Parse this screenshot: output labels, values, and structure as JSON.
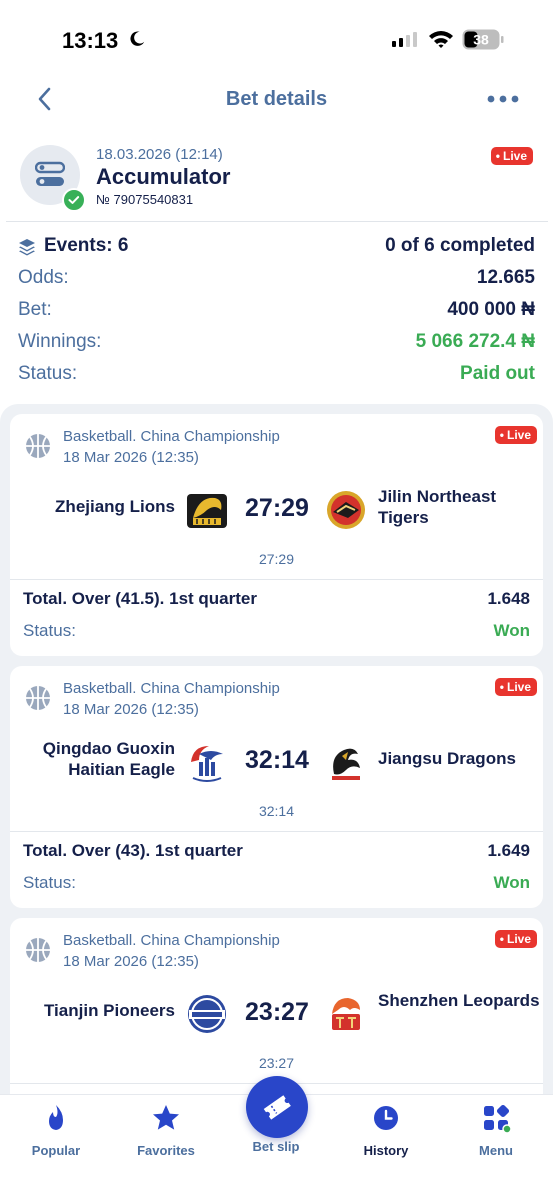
{
  "status_bar": {
    "time": "13:13",
    "battery": "38"
  },
  "nav": {
    "title": "Bet details"
  },
  "bet": {
    "date": "18.03.2026 (12:14)",
    "type": "Accumulator",
    "number": "№ 79075540831",
    "live_label": "Live"
  },
  "summary": {
    "events_label": "Events: 6",
    "events_value": "0 of 6 completed",
    "odds_label": "Odds:",
    "odds_value": "12.665",
    "bet_label": "Bet:",
    "bet_value": "400 000 ₦",
    "winnings_label": "Winnings:",
    "winnings_value": "5 066 272.4 ₦",
    "status_label": "Status:",
    "status_value": "Paid out"
  },
  "events": [
    {
      "league": "Basketball. China Championship",
      "date": "18 Mar 2026 (12:35)",
      "live_label": "Live",
      "team1": "Zhejiang Lions",
      "team2": "Jilin Northeast Tigers",
      "score": "27:29",
      "time": "27:29",
      "market": "Total. Over (41.5). 1st quarter",
      "odd": "1.648",
      "status_label": "Status:",
      "status_value": "Won"
    },
    {
      "league": "Basketball. China Championship",
      "date": "18 Mar 2026 (12:35)",
      "live_label": "Live",
      "team1": "Qingdao Guoxin Haitian Eagle",
      "team2": "Jiangsu Dragons",
      "score": "32:14",
      "time": "32:14",
      "market": "Total. Over (43). 1st quarter",
      "odd": "1.649",
      "status_label": "Status:",
      "status_value": "Won"
    },
    {
      "league": "Basketball. China Championship",
      "date": "18 Mar 2026 (12:35)",
      "live_label": "Live",
      "team1": "Tianjin Pioneers",
      "team2": "Shenzhen Leopards",
      "score": "23:27",
      "time": "23:27"
    }
  ],
  "tabbar": {
    "popular": "Popular",
    "favorites": "Favorites",
    "betslip": "Bet slip",
    "history": "History",
    "menu": "Menu"
  },
  "colors": {
    "accent_blue": "#2946c9",
    "text_muted": "#4c6f9e",
    "text_dark": "#15204a",
    "win_green": "#3aab54",
    "live_red": "#e8352e"
  },
  "icons": {
    "back": "chevron-left-icon",
    "more": "more-dots-icon",
    "events": "layers-icon",
    "sport": "basketball-icon",
    "popular": "fire-icon",
    "favorites": "star-icon",
    "betslip": "ticket-icon",
    "history": "clock-icon",
    "menu": "grid-icon"
  }
}
